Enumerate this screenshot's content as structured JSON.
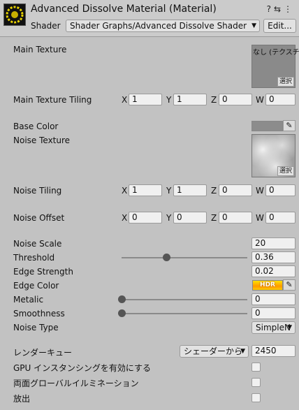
{
  "header": {
    "title": "Advanced Dissolve Material (Material)",
    "shader_label": "Shader",
    "shader_value": "Shader Graphs/Advanced Dissolve Shader",
    "edit_button": "Edit..."
  },
  "properties": {
    "main_texture": {
      "label": "Main Texture",
      "caption": "なし (テクスチャ)",
      "select": "選択"
    },
    "main_texture_tiling": {
      "label": "Main Texture Tiling",
      "x": "1",
      "y": "1",
      "z": "0",
      "w": "0"
    },
    "base_color": {
      "label": "Base Color",
      "color": "#8c8c8c"
    },
    "noise_texture": {
      "label": "Noise Texture",
      "select": "選択"
    },
    "noise_tiling": {
      "label": "Noise Tiling",
      "x": "1",
      "y": "1",
      "z": "0",
      "w": "0"
    },
    "noise_offset": {
      "label": "Noise Offset",
      "x": "0",
      "y": "0",
      "z": "0",
      "w": "0"
    },
    "noise_scale": {
      "label": "Noise Scale",
      "value": "20"
    },
    "threshold": {
      "label": "Threshold",
      "value": "0.36",
      "slider": 0.36
    },
    "edge_strength": {
      "label": "Edge Strength",
      "value": "0.02"
    },
    "edge_color": {
      "label": "Edge Color",
      "hdr": "HDR"
    },
    "metalic": {
      "label": "Metalic",
      "value": "0",
      "slider": 0
    },
    "smoothness": {
      "label": "Smoothness",
      "value": "0",
      "slider": 0
    },
    "noise_type": {
      "label": "Noise Type",
      "value": "SimpleN"
    }
  },
  "axes": {
    "x": "X",
    "y": "Y",
    "z": "Z",
    "w": "W"
  },
  "render": {
    "queue_label": "レンダーキュー",
    "queue_dropdown": "シェーダーから",
    "queue_value": "2450",
    "gpu_instancing": "GPU インスタンシングを有効にする",
    "double_sided_gi": "両面グローバルイルミネーション",
    "emission": "放出"
  }
}
